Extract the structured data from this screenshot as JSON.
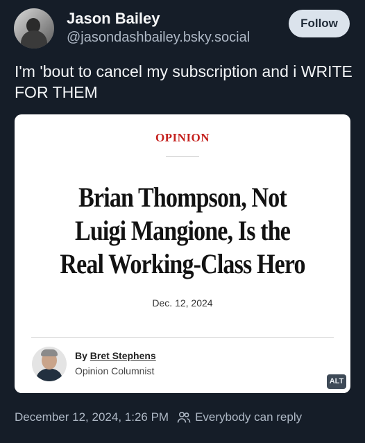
{
  "post": {
    "author_name": "Jason Bailey",
    "author_handle": "@jasondashbailey.bsky.social",
    "follow_label": "Follow",
    "text": "I'm 'bout to cancel my subscription and i WRITE FOR THEM",
    "timestamp": "December 12, 2024, 1:26 PM",
    "reply_setting": "Everybody can reply"
  },
  "embed": {
    "section": "OPINION",
    "headline": "Brian Thompson, Not Luigi Mangione, Is the Real Working-Class Hero",
    "date": "Dec. 12, 2024",
    "byline_prefix": "By",
    "author": "Bret Stephens",
    "author_role": "Opinion Columnist",
    "alt_label": "ALT"
  },
  "colors": {
    "background": "#151d28",
    "follow_bg": "#dbe3ec",
    "section_red": "#c5211e",
    "muted_text": "#aeb8c5"
  },
  "icons": {
    "reply_setting": "people-icon"
  }
}
